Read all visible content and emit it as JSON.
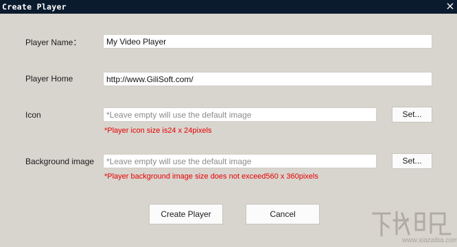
{
  "window": {
    "title": "Create Player"
  },
  "form": {
    "player_name": {
      "label": "Player Name：",
      "value": "My Video Player"
    },
    "player_home": {
      "label": "Player Home",
      "value": "http://www.GiliSoft.com/"
    },
    "icon": {
      "label": "Icon",
      "value": "",
      "placeholder": "*Leave empty will use the default image",
      "set_label": "Set...",
      "hint": "*Player icon size is24 x 24pixels"
    },
    "background_image": {
      "label": "Background image",
      "value": "",
      "placeholder": "*Leave empty will use the default image",
      "set_label": "Set...",
      "hint": "*Player background image size does not exceed560 x 360pixels"
    }
  },
  "actions": {
    "create_label": "Create Player",
    "cancel_label": "Cancel"
  },
  "watermark": {
    "text": "www.xiazaiba.com"
  },
  "colors": {
    "dialog_background": "#d8d4ce",
    "titlebar": "#0b1b2e",
    "hint_text": "#e60000"
  }
}
